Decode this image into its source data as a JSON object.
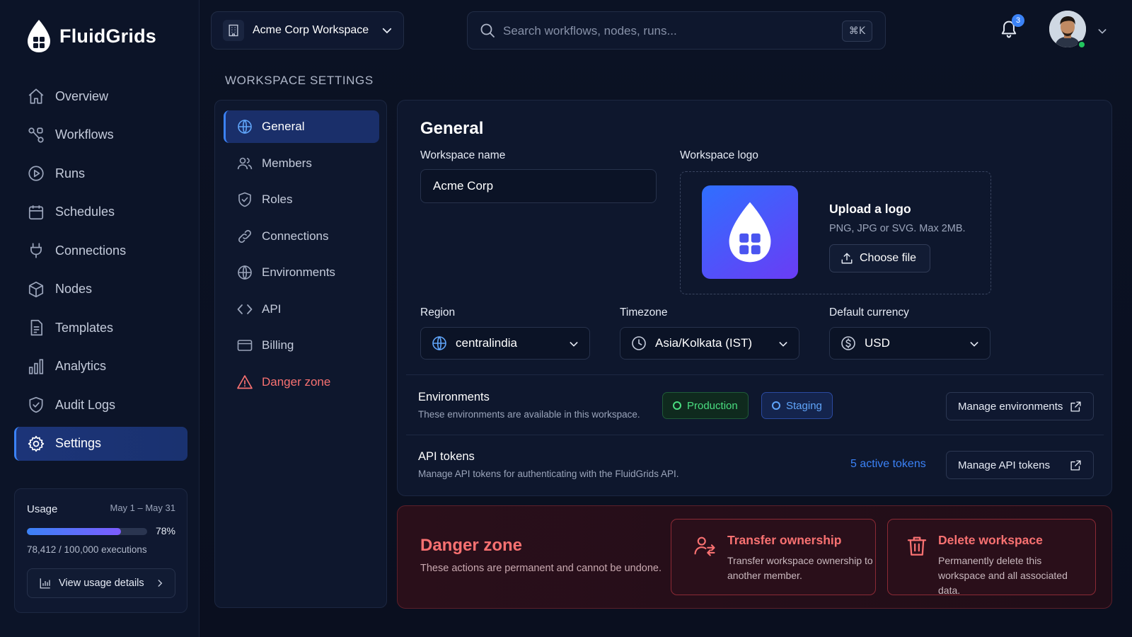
{
  "brand": {
    "name": "FluidGrids"
  },
  "sidebar": {
    "items": [
      {
        "label": "Overview",
        "icon": "home-icon"
      },
      {
        "label": "Workflows",
        "icon": "workflow-icon"
      },
      {
        "label": "Runs",
        "icon": "play-icon"
      },
      {
        "label": "Schedules",
        "icon": "calendar-icon"
      },
      {
        "label": "Connections",
        "icon": "plug-icon"
      },
      {
        "label": "Nodes",
        "icon": "cube-icon"
      },
      {
        "label": "Templates",
        "icon": "template-icon"
      },
      {
        "label": "Analytics",
        "icon": "bar-chart-icon"
      },
      {
        "label": "Audit Logs",
        "icon": "shield-check-icon"
      },
      {
        "label": "Settings",
        "icon": "gear-icon"
      }
    ],
    "active_index": 9
  },
  "usage": {
    "title": "Usage",
    "date_range": "May 1 – May 31",
    "percent": 78,
    "percent_label": "78%",
    "count_label": "78,412 / 100,000 executions",
    "button_label": "View usage details"
  },
  "topbar": {
    "workspace_label": "Acme Corp Workspace",
    "search_placeholder": "Search workflows, nodes, runs...",
    "search_shortcut": "⌘K",
    "notification_count": "3"
  },
  "page": {
    "section_heading": "WORKSPACE SETTINGS"
  },
  "settings_nav": {
    "items": [
      {
        "label": "General",
        "icon": "globe-icon"
      },
      {
        "label": "Members",
        "icon": "users-icon"
      },
      {
        "label": "Roles",
        "icon": "shield-icon"
      },
      {
        "label": "Connections",
        "icon": "link-icon"
      },
      {
        "label": "Environments",
        "icon": "globe-icon"
      },
      {
        "label": "API",
        "icon": "code-icon"
      },
      {
        "label": "Billing",
        "icon": "card-icon"
      },
      {
        "label": "Danger zone",
        "icon": "warning-icon"
      }
    ],
    "active_index": 0
  },
  "general": {
    "title": "General",
    "workspace_name_label": "Workspace name",
    "workspace_name_value": "Acme Corp",
    "logo_label": "Workspace logo",
    "upload_title": "Upload a logo",
    "upload_hint": "PNG, JPG or SVG. Max 2MB.",
    "choose_file_label": "Choose file",
    "region_label": "Region",
    "region_value": "centralindia",
    "timezone_label": "Timezone",
    "timezone_value": "Asia/Kolkata (IST)",
    "currency_label": "Default currency",
    "currency_value": "USD",
    "environments_title": "Environments",
    "environments_desc": "These environments are available in this workspace.",
    "env_production": "Production",
    "env_staging": "Staging",
    "manage_env_label": "Manage environments",
    "api_title": "API tokens",
    "api_desc": "Manage API tokens for authenticating with the FluidGrids API.",
    "active_tokens_label": "5 active tokens",
    "manage_api_label": "Manage API tokens"
  },
  "danger": {
    "title": "Danger zone",
    "desc": "These actions are permanent and cannot be undone.",
    "transfer_title": "Transfer ownership",
    "transfer_desc": "Transfer workspace ownership to another member.",
    "delete_title": "Delete workspace",
    "delete_desc": "Permanently delete this workspace and all associated data."
  },
  "colors": {
    "accent": "#3b82f6",
    "danger": "#f87171",
    "success": "#4ade80",
    "background": "#0a1020"
  }
}
